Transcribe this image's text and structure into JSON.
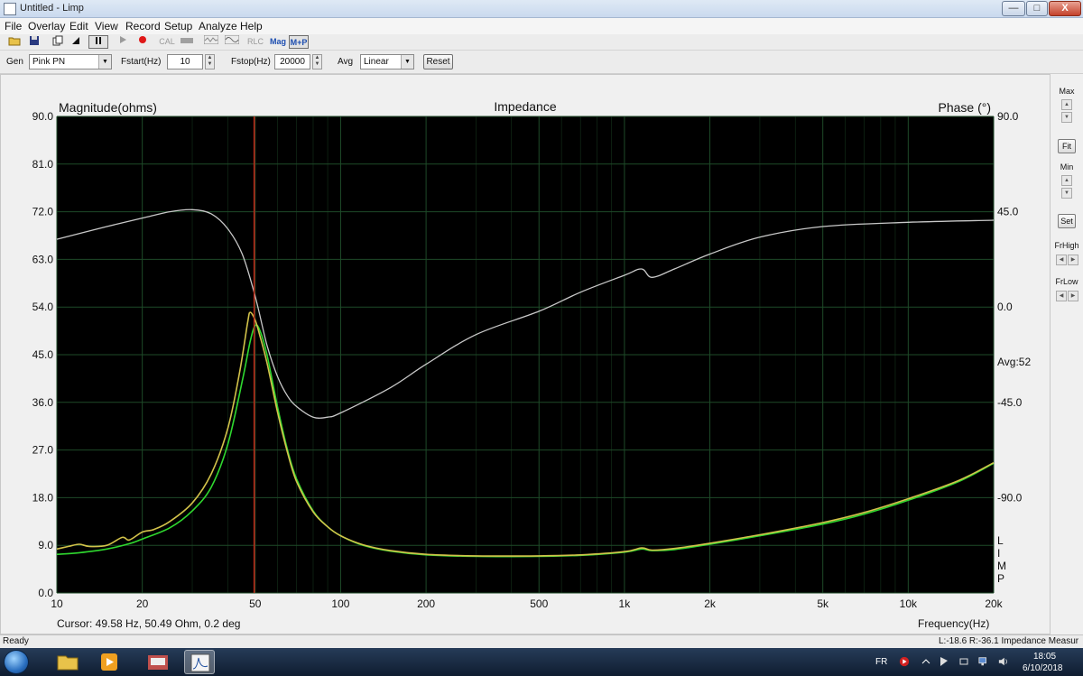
{
  "window": {
    "title": "Untitled - Limp",
    "min_label": "—",
    "max_label": "□",
    "close_label": "X"
  },
  "menu": [
    "File",
    "Overlay",
    "Edit",
    "View",
    "Record",
    "Setup",
    "Analyze",
    "Help"
  ],
  "toolbar": {
    "cal_label": "CAL",
    "rlc_label": "RLC",
    "mag_label": "Mag",
    "mp_label": "M+P"
  },
  "controls": {
    "gen_label": "Gen",
    "gen_value": "Pink PN",
    "fstart_label": "Fstart(Hz)",
    "fstart_value": "10",
    "fstop_label": "Fstop(Hz)",
    "fstop_value": "20000",
    "avg_label": "Avg",
    "avg_value": "Linear",
    "reset_label": "Reset"
  },
  "side_panel": {
    "max_label": "Max",
    "fit_label": "Fit",
    "min_label": "Min",
    "set_label": "Set",
    "frhigh_label": "FrHigh",
    "frlow_label": "FrLow"
  },
  "chart_data": {
    "type": "line",
    "title": "Impedance",
    "ylabel": "Magnitude(ohms)",
    "y2label": "Phase (°)",
    "xlabel": "Frequency(Hz)",
    "x_scale": "log",
    "xlim": [
      10,
      20000
    ],
    "ylim": [
      0,
      90
    ],
    "y2lim": [
      -135,
      90
    ],
    "x_ticks": [
      10,
      20,
      50,
      100,
      200,
      500,
      1000,
      2000,
      5000,
      10000,
      20000
    ],
    "x_tick_labels": [
      "10",
      "20",
      "50",
      "100",
      "200",
      "500",
      "1k",
      "2k",
      "5k",
      "10k",
      "20k"
    ],
    "y_tick_labels": [
      "0.0",
      "9.0",
      "18.0",
      "27.0",
      "36.0",
      "45.0",
      "54.0",
      "63.0",
      "72.0",
      "81.0",
      "90.0"
    ],
    "y2_ticks": [
      90,
      45,
      0,
      -45,
      -90
    ],
    "y2_tick_labels": [
      "90.0",
      "45.0",
      "0.0",
      "-45.0",
      "-90.0"
    ],
    "avg_label": "Avg:52",
    "limp_label": [
      "L",
      "I",
      "M",
      "P"
    ],
    "cursor_freq": 49.58,
    "cursor_text": "Cursor: 49.58 Hz, 50.49 Ohm, 0.2 deg",
    "colors": {
      "background": "#000000",
      "grid": "#1e4a28",
      "magnitude": "#2fd82f",
      "magnitude_ref": "#d2c24a",
      "phase": "#c8c8c8",
      "cursor": "#c02818"
    },
    "series": [
      {
        "axis": "magnitude",
        "color": "#2fd82f",
        "points": [
          [
            10,
            7.3
          ],
          [
            12,
            7.6
          ],
          [
            15,
            8.3
          ],
          [
            18,
            9.3
          ],
          [
            20,
            10.2
          ],
          [
            25,
            12.3
          ],
          [
            30,
            15.5
          ],
          [
            35,
            20.0
          ],
          [
            40,
            28.0
          ],
          [
            45,
            40.0
          ],
          [
            48,
            47.5
          ],
          [
            50,
            50.5
          ],
          [
            52,
            49.5
          ],
          [
            55,
            45.0
          ],
          [
            60,
            35.0
          ],
          [
            65,
            27.0
          ],
          [
            70,
            21.5
          ],
          [
            80,
            15.5
          ],
          [
            90,
            12.5
          ],
          [
            100,
            10.8
          ],
          [
            120,
            9.0
          ],
          [
            150,
            7.9
          ],
          [
            200,
            7.2
          ],
          [
            300,
            6.9
          ],
          [
            500,
            6.9
          ],
          [
            700,
            7.1
          ],
          [
            1000,
            7.7
          ],
          [
            1150,
            8.3
          ],
          [
            1250,
            8.0
          ],
          [
            1500,
            8.2
          ],
          [
            2000,
            9.2
          ],
          [
            3000,
            10.8
          ],
          [
            5000,
            13.0
          ],
          [
            7000,
            14.9
          ],
          [
            10000,
            17.5
          ],
          [
            15000,
            21.0
          ],
          [
            20000,
            24.5
          ]
        ]
      },
      {
        "axis": "magnitude",
        "color": "#d2c24a",
        "points": [
          [
            10,
            8.3
          ],
          [
            11,
            8.8
          ],
          [
            12,
            9.2
          ],
          [
            13,
            8.8
          ],
          [
            15,
            9.0
          ],
          [
            17,
            10.5
          ],
          [
            18,
            10.0
          ],
          [
            20,
            11.5
          ],
          [
            22,
            12.0
          ],
          [
            25,
            13.5
          ],
          [
            30,
            17.0
          ],
          [
            35,
            22.5
          ],
          [
            40,
            31.0
          ],
          [
            44,
            41.5
          ],
          [
            47,
            51.0
          ],
          [
            48,
            53.0
          ],
          [
            50,
            51.5
          ],
          [
            52,
            48.5
          ],
          [
            55,
            43.5
          ],
          [
            60,
            34.0
          ],
          [
            65,
            26.5
          ],
          [
            70,
            21.0
          ],
          [
            80,
            15.3
          ],
          [
            90,
            12.5
          ],
          [
            100,
            10.8
          ],
          [
            120,
            9.1
          ],
          [
            150,
            8.0
          ],
          [
            200,
            7.3
          ],
          [
            300,
            7.0
          ],
          [
            500,
            7.0
          ],
          [
            700,
            7.2
          ],
          [
            1000,
            7.8
          ],
          [
            1150,
            8.5
          ],
          [
            1250,
            8.1
          ],
          [
            1500,
            8.4
          ],
          [
            2000,
            9.4
          ],
          [
            3000,
            11.0
          ],
          [
            5000,
            13.3
          ],
          [
            7000,
            15.2
          ],
          [
            10000,
            17.8
          ],
          [
            15000,
            21.2
          ],
          [
            20000,
            24.6
          ]
        ]
      },
      {
        "axis": "phase",
        "color": "#c8c8c8",
        "points": [
          [
            10,
            32.0
          ],
          [
            15,
            38.0
          ],
          [
            20,
            42.0
          ],
          [
            25,
            45.0
          ],
          [
            30,
            46.0
          ],
          [
            35,
            44.0
          ],
          [
            40,
            37.0
          ],
          [
            45,
            25.0
          ],
          [
            50,
            5.0
          ],
          [
            55,
            -18.0
          ],
          [
            60,
            -33.0
          ],
          [
            65,
            -42.0
          ],
          [
            70,
            -47.0
          ],
          [
            80,
            -52.0
          ],
          [
            90,
            -52.0
          ],
          [
            100,
            -50.0
          ],
          [
            150,
            -38.0
          ],
          [
            200,
            -27.0
          ],
          [
            300,
            -13.0
          ],
          [
            500,
            -2.0
          ],
          [
            700,
            7.0
          ],
          [
            1000,
            15.0
          ],
          [
            1150,
            18.0
          ],
          [
            1250,
            14.0
          ],
          [
            1500,
            18.0
          ],
          [
            2000,
            25.0
          ],
          [
            3000,
            33.0
          ],
          [
            5000,
            38.0
          ],
          [
            10000,
            40.0
          ],
          [
            20000,
            41.0
          ]
        ]
      }
    ]
  },
  "status": {
    "left": "Ready",
    "right": "L:-18.6 R:-36.1  Impedance Measur"
  },
  "taskbar": {
    "lang": "FR",
    "time": "18:05",
    "date": "6/10/2018"
  }
}
